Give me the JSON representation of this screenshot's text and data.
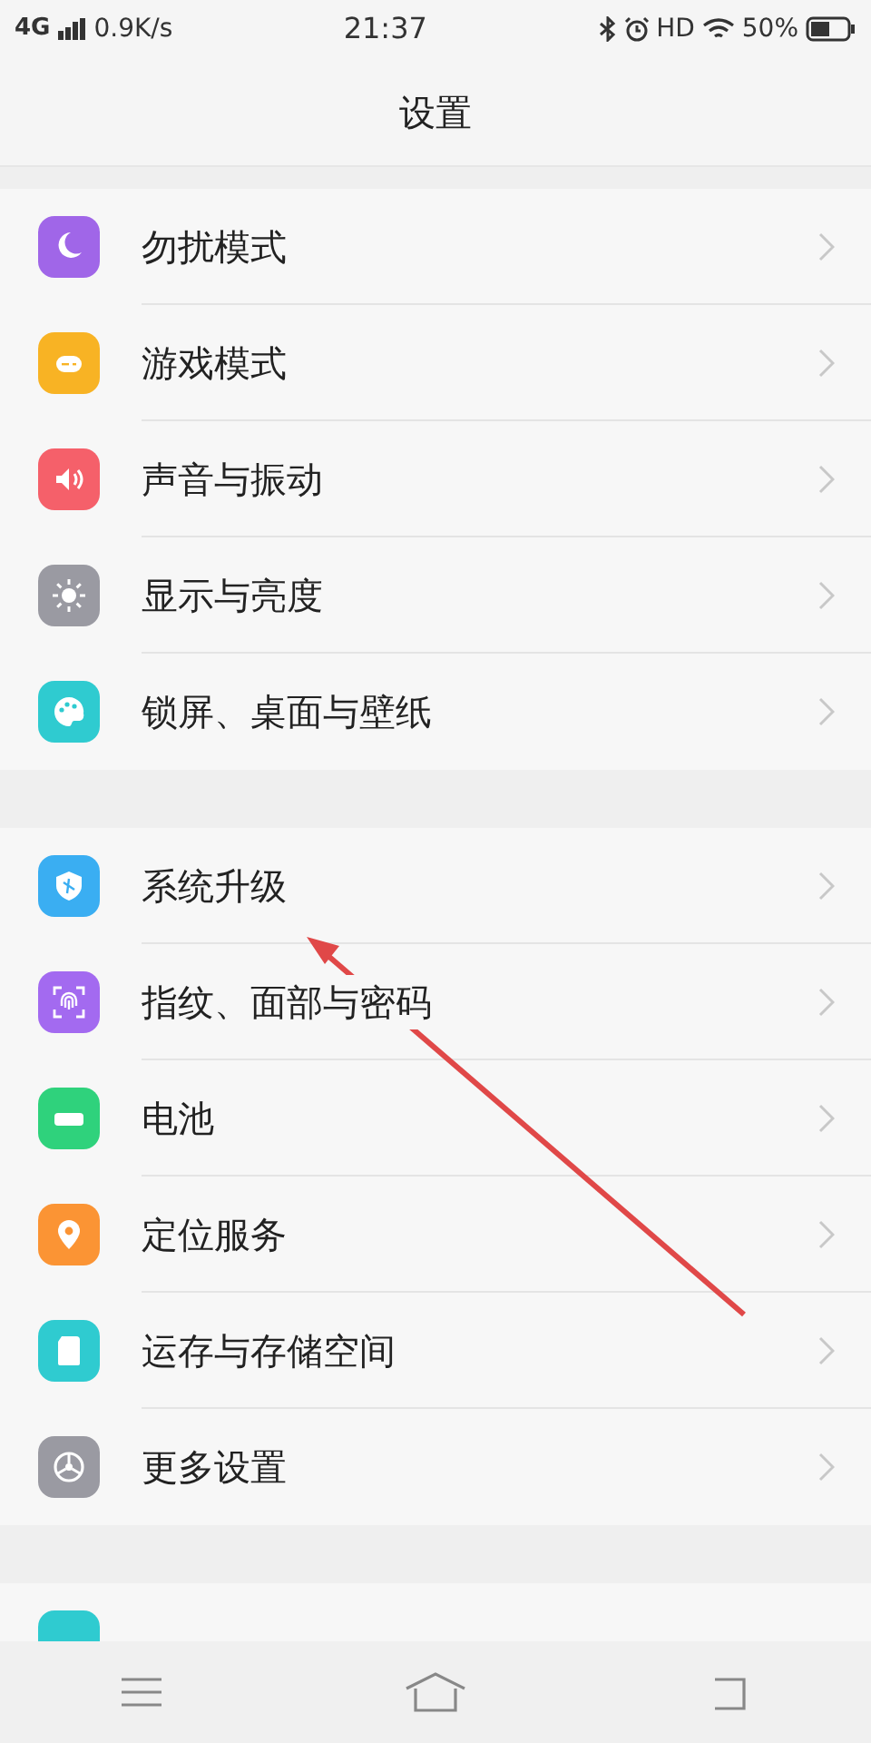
{
  "status_bar": {
    "network": "4G",
    "speed": "0.9K/s",
    "time": "21:37",
    "hd": "HD",
    "battery": "50%"
  },
  "title": "设置",
  "groups": [
    {
      "items": [
        {
          "label": "勿扰模式",
          "color": "#a066e8"
        },
        {
          "label": "游戏模式",
          "color": "#f8b324"
        },
        {
          "label": "声音与振动",
          "color": "#f5606a"
        },
        {
          "label": "显示与亮度",
          "color": "#9a9aa2"
        },
        {
          "label": "锁屏、桌面与壁纸",
          "color": "#2fcbd0"
        }
      ]
    },
    {
      "items": [
        {
          "label": "系统升级",
          "color": "#3aaef2"
        },
        {
          "label": "指纹、面部与密码",
          "color": "#a36af0"
        },
        {
          "label": "电池",
          "color": "#2fd27c"
        },
        {
          "label": "定位服务",
          "color": "#fb9434"
        },
        {
          "label": "运存与存储空间",
          "color": "#2fcbd0"
        },
        {
          "label": "更多设置",
          "color": "#9a9aa2"
        }
      ]
    },
    {
      "items": [
        {
          "color": "#2fcbd0"
        }
      ]
    }
  ]
}
